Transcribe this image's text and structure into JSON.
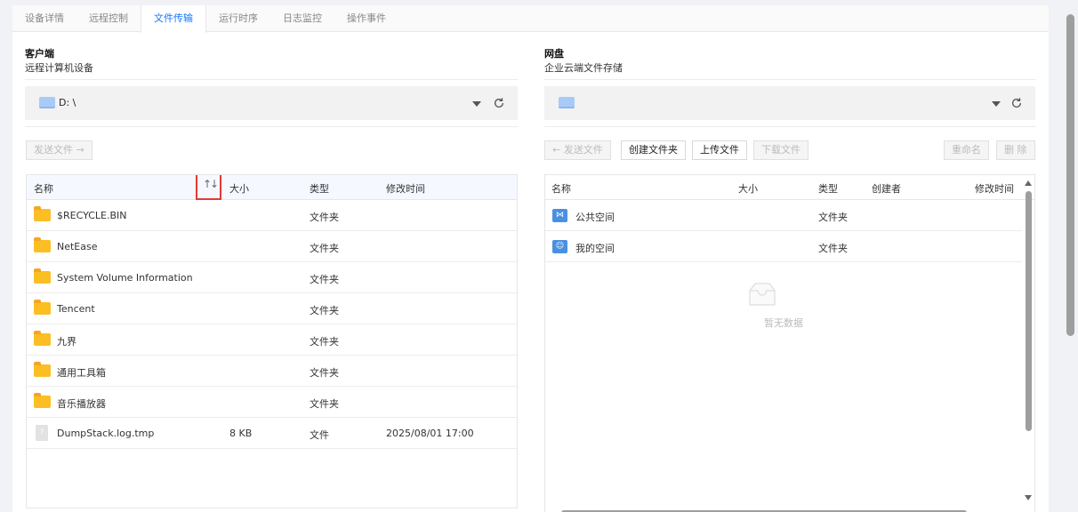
{
  "tabs": [
    {
      "label": "设备详情",
      "active": false
    },
    {
      "label": "远程控制",
      "active": false
    },
    {
      "label": "文件传输",
      "active": true
    },
    {
      "label": "运行时序",
      "active": false
    },
    {
      "label": "日志监控",
      "active": false
    },
    {
      "label": "操作事件",
      "active": false
    }
  ],
  "client": {
    "title": "客户端",
    "subtitle": "远程计算机设备",
    "path": "D: \\",
    "send_button": "发送文件 →",
    "columns": {
      "name": "名称",
      "size": "大小",
      "type": "类型",
      "modified": "修改时间"
    },
    "sort_icon": "↑↓",
    "rows": [
      {
        "name": "$RECYCLE.BIN",
        "size": "",
        "type": "文件夹",
        "modified": "",
        "icon": "folder-icon"
      },
      {
        "name": "NetEase",
        "size": "",
        "type": "文件夹",
        "modified": "",
        "icon": "folder-icon"
      },
      {
        "name": "System Volume Information",
        "size": "",
        "type": "文件夹",
        "modified": "",
        "icon": "folder-icon"
      },
      {
        "name": "Tencent",
        "size": "",
        "type": "文件夹",
        "modified": "",
        "icon": "folder-icon"
      },
      {
        "name": "九界",
        "size": "",
        "type": "文件夹",
        "modified": "",
        "icon": "folder-icon"
      },
      {
        "name": "通用工具箱",
        "size": "",
        "type": "文件夹",
        "modified": "",
        "icon": "folder-icon"
      },
      {
        "name": "音乐播放器",
        "size": "",
        "type": "文件夹",
        "modified": "",
        "icon": "folder-icon"
      },
      {
        "name": "DumpStack.log.tmp",
        "size": "8 KB",
        "type": "文件",
        "modified": "2025/08/01 17:00",
        "icon": "unknown-file-icon"
      }
    ]
  },
  "cloud": {
    "title": "网盘",
    "subtitle": "企业云端文件存储",
    "path": "",
    "buttons": {
      "send": "← 发送文件",
      "create_folder": "创建文件夹",
      "upload": "上传文件",
      "download": "下载文件",
      "rename": "重命名",
      "delete": "删 除"
    },
    "columns": {
      "name": "名称",
      "size": "大小",
      "type": "类型",
      "creator": "创建者",
      "modified": "修改时间"
    },
    "rows": [
      {
        "name": "公共空间",
        "type": "文件夹",
        "icon": "shared-space-icon"
      },
      {
        "name": "我的空间",
        "type": "文件夹",
        "icon": "personal-space-icon"
      }
    ],
    "empty_text": "暂无数据"
  },
  "colors": {
    "accent": "#1677ff",
    "folder": "#fbbf24",
    "highlight": "#e53935"
  }
}
